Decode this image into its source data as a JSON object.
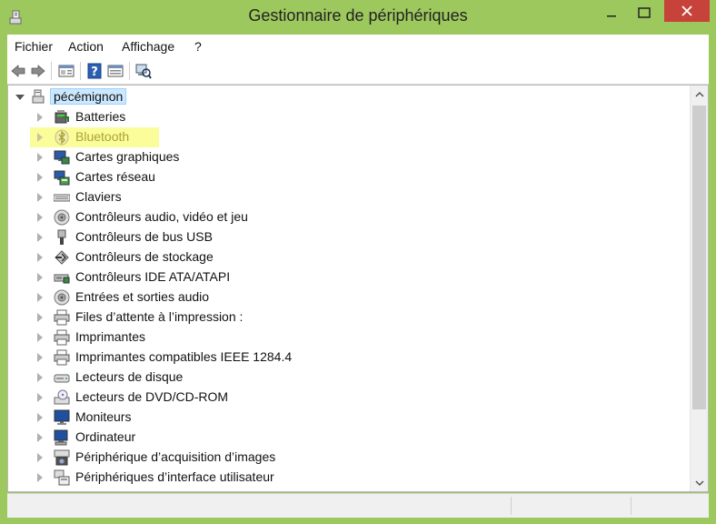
{
  "window": {
    "title": "Gestionnaire de périphériques",
    "accent": "#9cc85e",
    "close_color": "#c7423b"
  },
  "menu": [
    "Fichier",
    "Action",
    "Affichage",
    "?"
  ],
  "toolbar": {
    "icons": [
      "back-icon",
      "forward-icon",
      "properties-view-icon",
      "help-icon",
      "view-icon",
      "scan-hardware-icon"
    ]
  },
  "tree": {
    "root": "pécémignon",
    "items": [
      {
        "label": "Batteries",
        "icon": "battery-icon"
      },
      {
        "label": "Bluetooth",
        "icon": "bluetooth-icon",
        "highlighted": true
      },
      {
        "label": "Cartes graphiques",
        "icon": "display-adapter-icon"
      },
      {
        "label": "Cartes réseau",
        "icon": "network-adapter-icon"
      },
      {
        "label": "Claviers",
        "icon": "keyboard-icon"
      },
      {
        "label": "Contrôleurs audio, vidéo et jeu",
        "icon": "audio-icon"
      },
      {
        "label": "Contrôleurs de bus USB",
        "icon": "usb-icon"
      },
      {
        "label": "Contrôleurs de stockage",
        "icon": "storage-controller-icon"
      },
      {
        "label": "Contrôleurs IDE ATA/ATAPI",
        "icon": "ide-controller-icon"
      },
      {
        "label": "Entrées et sorties audio",
        "icon": "audio-io-icon"
      },
      {
        "label": "Files d’attente à l’impression :",
        "icon": "print-queue-icon"
      },
      {
        "label": "Imprimantes",
        "icon": "printer-icon"
      },
      {
        "label": "Imprimantes compatibles IEEE 1284.4",
        "icon": "printer-ieee-icon"
      },
      {
        "label": "Lecteurs de disque",
        "icon": "disk-drive-icon"
      },
      {
        "label": "Lecteurs de DVD/CD-ROM",
        "icon": "dvd-drive-icon"
      },
      {
        "label": "Moniteurs",
        "icon": "monitor-icon"
      },
      {
        "label": "Ordinateur",
        "icon": "computer-icon"
      },
      {
        "label": "Périphérique d’acquisition d’images",
        "icon": "imaging-device-icon"
      },
      {
        "label": "Périphériques d’interface utilisateur",
        "icon": "hid-icon"
      }
    ]
  }
}
